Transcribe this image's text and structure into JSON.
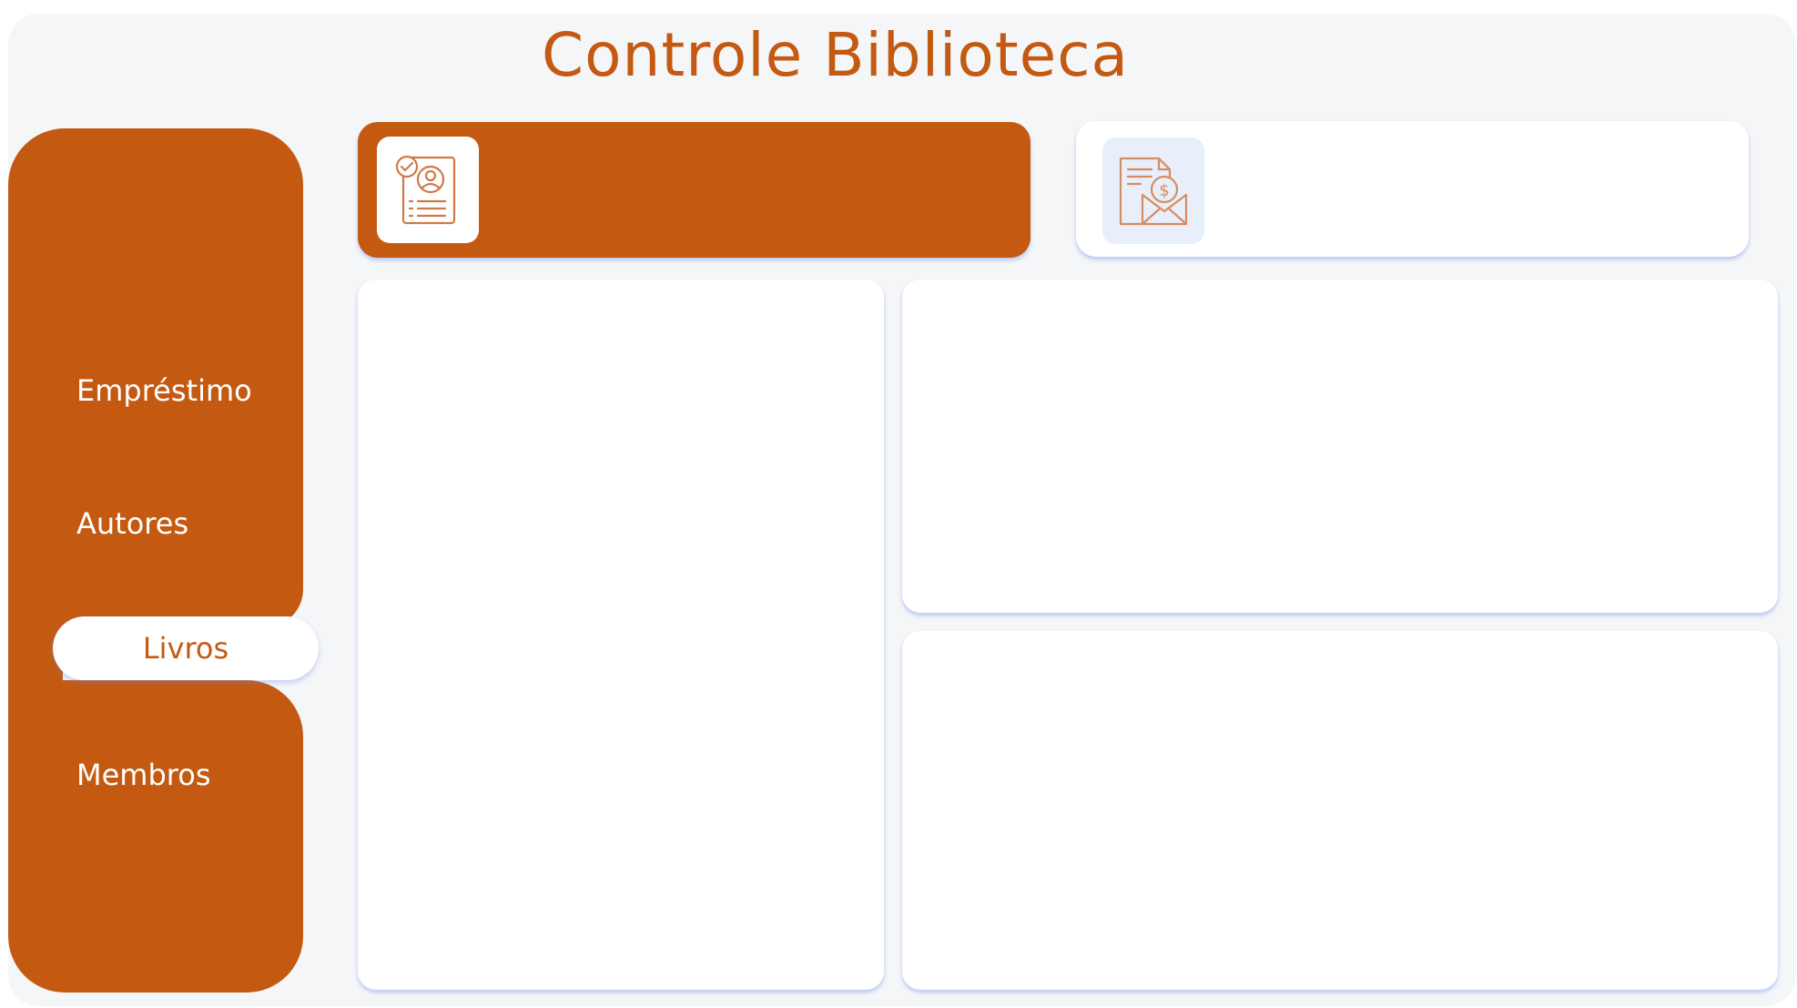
{
  "header": {
    "title": "Controle Biblioteca"
  },
  "sidebar": {
    "items": [
      {
        "label": "Empréstimo"
      },
      {
        "label": "Autores"
      },
      {
        "label": "Livros",
        "active": true
      },
      {
        "label": "Membros"
      }
    ]
  },
  "kpis": [
    {
      "icon": "member-profile-checklist-icon"
    },
    {
      "icon": "invoice-envelope-dollar-icon"
    }
  ],
  "theme": {
    "accent": "#c45a12",
    "background": "#f4f6f8",
    "card": "#ffffff"
  }
}
